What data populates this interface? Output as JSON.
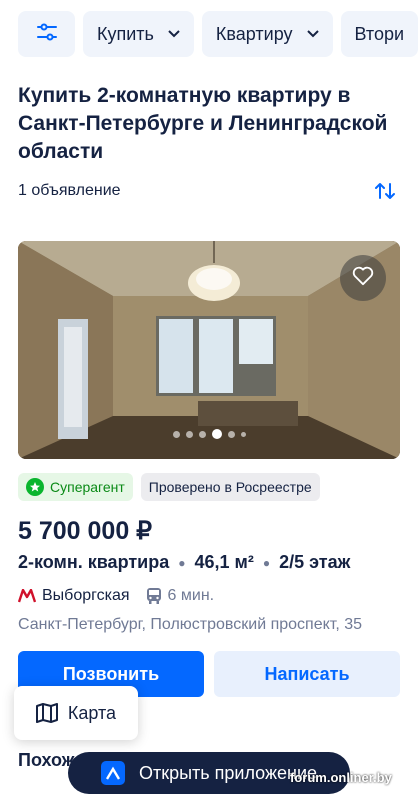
{
  "filters": {
    "settings_icon": "sliders-icon",
    "deal": "Купить",
    "property_type": "Квартиру",
    "market": "Втори"
  },
  "listing_title": "Купить 2-комнатную квартиру в Санкт-Петербурге и Ленинградской области",
  "results_count": "1 объявление",
  "card": {
    "photo_count": 6,
    "active_photo": 3,
    "badges": {
      "superagent": "Суперагент",
      "verified": "Проверено в Росреестре"
    },
    "price": "5 700 000 ₽",
    "rooms": "2-комн. квартира",
    "area": "46,1 м²",
    "floor": "2/5 этаж",
    "metro_station": "Выборгская",
    "metro_time": "6 мин.",
    "address": "Санкт-Петербург, Полюстровский проспект, 35",
    "call_label": "Позвонить",
    "write_label": "Написать"
  },
  "map_label": "Карта",
  "similar_label": "Похож",
  "open_app_label": "Открыть приложение",
  "watermark": "forum.onliner.by",
  "colors": {
    "accent": "#0468ff",
    "text": "#152242",
    "metro": "#d0112b",
    "superagent": "#0ab52e"
  }
}
